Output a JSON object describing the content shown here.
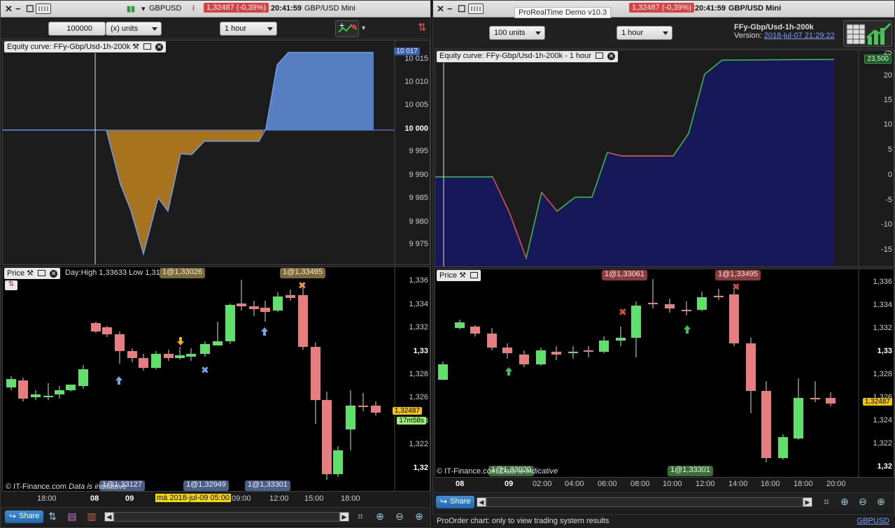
{
  "left": {
    "title": {
      "symbol": "GBPUSD",
      "price_change": "1,32487 (-0,39%)",
      "time": "20:41:59",
      "instrument": "GBP/USD Mini"
    },
    "toolbar": {
      "quantity": "100000",
      "units": "(x) units",
      "timeframe": "1 hour"
    },
    "equity": {
      "label": "Equity curve: FFy-Gbp/Usd-1h-200k",
      "y_ticks": [
        "10 015",
        "10 010",
        "10 005",
        "10 000",
        "9 995",
        "9 990",
        "9 985",
        "9 980",
        "9 975"
      ],
      "current_tag": "10 017"
    },
    "price": {
      "label": "Price",
      "day_info": "Day:High 1,33633 Low 1,31",
      "y_ticks": [
        "1,336",
        "1,334",
        "1,332",
        "1,33",
        "1,328",
        "1,326",
        "1,324",
        "1,322",
        "1,32"
      ],
      "price_tag": "1,32487",
      "countdown_tag": "17m58s",
      "order_tags_top": [
        "1@1,33026",
        "1@1,33495"
      ],
      "order_tags_bottom": [
        "1@1,33127",
        "1@1,32949",
        "1@1,33301"
      ],
      "copyright": "© IT-Finance.com",
      "indicative": "Data is indicative",
      "x_ticks": [
        "18:00",
        "08",
        "09",
        "má 2018-jul-09 05:00",
        "09:00",
        "12:00",
        "15:00",
        "18:00"
      ]
    },
    "bottombar": {
      "share": "Share"
    }
  },
  "right": {
    "title": {
      "tooltip": "ProRealTime Demo v10.3",
      "price_change": "1,32487 (-0,39%)",
      "time": "20:41:59",
      "instrument": "GBP/USD Mini"
    },
    "toolbar": {
      "units": "100 units",
      "timeframe": "1 hour",
      "system_name": "FFy-Gbp/Usd-1h-200k",
      "version_label": "Version:",
      "version_date": "2018-jul-07 21:29:22"
    },
    "equity": {
      "label": "Equity curve: FFy-Gbp/Usd-1h-200k - 1 hour",
      "y_ticks": [
        "25",
        "20",
        "15",
        "10",
        "5",
        "0",
        "-5",
        "-10",
        "-15"
      ],
      "current_tag": "23,500"
    },
    "price": {
      "label": "Price",
      "y_ticks": [
        "1,336",
        "1,334",
        "1,332",
        "1,33",
        "1,328",
        "1,326",
        "1,324",
        "1,322",
        "1,32"
      ],
      "price_tag": "1,32487",
      "order_tags_top": [
        "1@1,33061",
        "1@1,33495"
      ],
      "order_tags_bottom": [
        "1@1,33020",
        "1@1,33301"
      ],
      "copyright": "© IT-Finance.com",
      "indicative": "Data is indicative",
      "x_ticks": [
        "08",
        "09",
        "02:00",
        "04:00",
        "06:00",
        "08:00",
        "10:00",
        "12:00",
        "14:00",
        "16:00",
        "18:00",
        "20:00"
      ]
    },
    "bottombar": {
      "share": "Share"
    },
    "status": {
      "text": "ProOrder chart: only to view trading system results",
      "link": "GBPUSD"
    }
  },
  "colors": {
    "up": "#5fe06a",
    "down": "#e87d7d",
    "equity_gain_left": "#5b84c9",
    "equity_loss_left": "#b0781f",
    "equity_fill_right": "#16185a"
  }
}
